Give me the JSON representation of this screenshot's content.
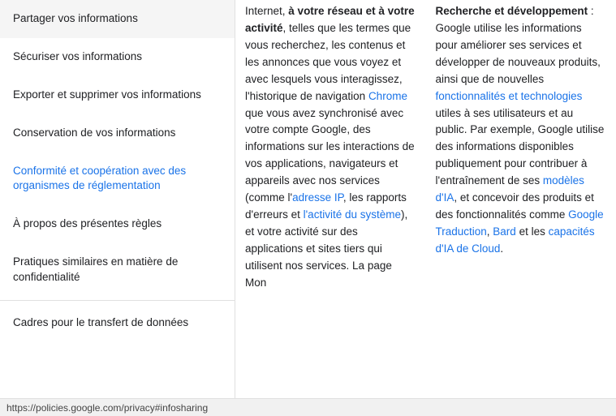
{
  "sidebar": {
    "items": [
      {
        "id": "partager",
        "label": "Partager vos informations",
        "active": false
      },
      {
        "id": "securiser",
        "label": "Sécuriser vos informations",
        "active": false
      },
      {
        "id": "exporter",
        "label": "Exporter et supprimer vos informations",
        "active": false
      },
      {
        "id": "conservation",
        "label": "Conservation de vos informations",
        "active": false
      },
      {
        "id": "conformite",
        "label": "Conformité et coopération avec des organismes de réglementation",
        "active": true
      },
      {
        "id": "apropos",
        "label": "À propos des présentes règles",
        "active": false
      },
      {
        "id": "pratiques",
        "label": "Pratiques similaires en matière de confidentialité",
        "active": false
      },
      {
        "id": "cadres",
        "label": "Cadres pour le transfert de données",
        "active": false
      }
    ]
  },
  "col1": {
    "text_parts": [
      {
        "type": "text",
        "content": "Internet, ",
        "bold": false,
        "link": false
      },
      {
        "type": "text",
        "content": "à votre réseau et à votre activité",
        "bold": true,
        "link": false
      },
      {
        "type": "text",
        "content": ", telles que les termes que vous recherchez, les contenus et les annonces que vous voyez et avec lesquels vous interagissez, l'historique de navigation Chrome que vous avez synchronisé avec votre compte Google, des informations sur les interactions de vos applications, navigateurs et appareils avec nos services (comme l'adresse IP, les rapports d'erreurs et l'activité du système), et votre activité sur des applications et sites tiers qui utilisent nos services. La page Mon",
        "bold": false,
        "link": false
      }
    ],
    "links": [
      "Chrome",
      "adresse IP",
      "l'activité du système"
    ]
  },
  "col2": {
    "title_bold": "Recherche et développement",
    "title_suffix": " : Google utilise les informations pour améliorer ses services et développer de nouveaux produits, ainsi que de nouvelles fonctionnalités et technologies utiles à ses utilisateurs et au public. Par exemple, Google utilise des informations disponibles publiquement pour contribuer à l'entraînement de ses modèles d'IA, et concevoir des produits et des fonctionnalités comme Google Traduction, Bard et les capacités d'IA de Cloud.",
    "links": [
      "fonctionnalités et technologies",
      "modèles d'IA",
      "Google Traduction",
      "Bard",
      "capacités d'IA de Cloud"
    ]
  },
  "statusbar": {
    "url": "https://policies.google.com/privacy#infosharing"
  }
}
